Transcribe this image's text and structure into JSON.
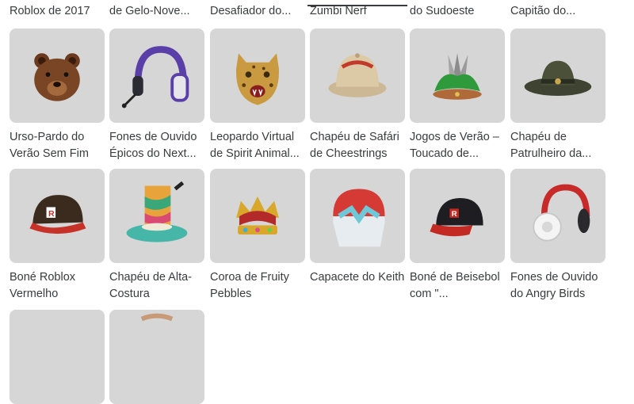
{
  "top_row": [
    "Roblox de 2017",
    "de Gelo-Nove...",
    "Desafiador do...",
    "Zumbi Nerf",
    "do Sudoeste",
    "Capitão do..."
  ],
  "items": [
    {
      "name": "Urso-Pardo do Verão Sem Fim",
      "icon": "bear-head-icon"
    },
    {
      "name": "Fones de Ouvido Épicos do Next...",
      "icon": "headphones-purple-icon"
    },
    {
      "name": "Leopardo Virtual de Spirit Animal...",
      "icon": "leopard-head-icon"
    },
    {
      "name": "Chapéu de Safári de Cheestrings",
      "icon": "safari-hat-icon"
    },
    {
      "name": "Jogos de Verão – Toucado de...",
      "icon": "feather-headdress-icon"
    },
    {
      "name": "Chapéu de Patrulheiro da...",
      "icon": "ranger-hat-icon"
    },
    {
      "name": "Boné Roblox Vermelho",
      "icon": "roblox-cap-icon"
    },
    {
      "name": "Chapéu de Alta-Costura",
      "icon": "couture-hat-icon"
    },
    {
      "name": "Coroa de Fruity Pebbles",
      "icon": "crown-icon"
    },
    {
      "name": "Capacete do Keith",
      "icon": "helmet-icon"
    },
    {
      "name": "Boné de Beisebol com \"...",
      "icon": "baseball-cap-icon"
    },
    {
      "name": "Fones de Ouvido do Angry Birds",
      "icon": "headphones-white-icon"
    }
  ]
}
